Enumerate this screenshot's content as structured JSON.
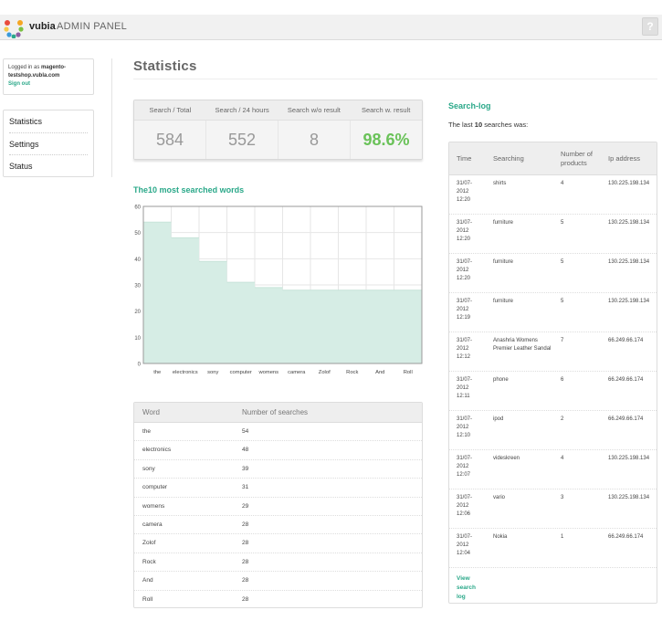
{
  "header": {
    "brand": "vubia",
    "panel_title": "ADMIN PANEL",
    "help_label": "?",
    "colors": {
      "bar": "#f1f1f1",
      "accent": "#2aa889"
    }
  },
  "sidebar": {
    "logged_in_prefix": "Logged in as",
    "user": "magento-testshop.vubla.com",
    "sign_out": "Sign out",
    "menu": [
      {
        "label": "Statistics"
      },
      {
        "label": "Settings"
      },
      {
        "label": "Status"
      }
    ]
  },
  "page": {
    "title": "Statistics"
  },
  "stats": {
    "headers": [
      "Search / Total",
      "Search / 24 hours",
      "Search w/o result",
      "Search w. result"
    ],
    "values": [
      "584",
      "552",
      "8",
      "98.6%"
    ]
  },
  "chart_section": {
    "title_prefix": "The",
    "title_count": "10",
    "title_suffix": "most searched words"
  },
  "chart_data": {
    "type": "area",
    "categories": [
      "the",
      "electronics",
      "sony",
      "computer",
      "womens",
      "camera",
      "Zolof",
      "Rock",
      "And",
      "Roll"
    ],
    "values": [
      54,
      48,
      39,
      31,
      29,
      28,
      28,
      28,
      28,
      28
    ],
    "ylim": [
      0,
      60
    ],
    "yticks": [
      0,
      10,
      20,
      30,
      40,
      50,
      60
    ],
    "grid": true,
    "color": "#d6ede5"
  },
  "words_table": {
    "headers": [
      "Word",
      "Number of searches"
    ],
    "rows": [
      {
        "word": "the",
        "count": "54"
      },
      {
        "word": "electronics",
        "count": "48"
      },
      {
        "word": "sony",
        "count": "39"
      },
      {
        "word": "computer",
        "count": "31"
      },
      {
        "word": "womens",
        "count": "29"
      },
      {
        "word": "camera",
        "count": "28"
      },
      {
        "word": "Zolof",
        "count": "28"
      },
      {
        "word": "Rock",
        "count": "28"
      },
      {
        "word": "And",
        "count": "28"
      },
      {
        "word": "Roll",
        "count": "28"
      }
    ]
  },
  "search_log": {
    "title": "Search-log",
    "subtitle_prefix": "The last",
    "subtitle_count": "10",
    "subtitle_suffix": "searches was:",
    "headers": [
      "Time",
      "Searching",
      "Number of products",
      "Ip address"
    ],
    "rows": [
      {
        "time": [
          "31/07-",
          "2012",
          "12:20"
        ],
        "search": "shirts",
        "products": "4",
        "ip": "130.225.198.134"
      },
      {
        "time": [
          "31/07-",
          "2012",
          "12:20"
        ],
        "search": "furniture",
        "products": "5",
        "ip": "130.225.198.134"
      },
      {
        "time": [
          "31/07-",
          "2012",
          "12:20"
        ],
        "search": "furniture",
        "products": "5",
        "ip": "130.225.198.134"
      },
      {
        "time": [
          "31/07-",
          "2012",
          "12:19"
        ],
        "search": "furniture",
        "products": "5",
        "ip": "130.225.198.134"
      },
      {
        "time": [
          "31/07-",
          "2012",
          "12:12"
        ],
        "search": "Anashria Womens Premier Leather Sandal",
        "products": "7",
        "ip": "66.249.66.174"
      },
      {
        "time": [
          "31/07-",
          "2012",
          "12:11"
        ],
        "search": "phone",
        "products": "6",
        "ip": "66.249.66.174"
      },
      {
        "time": [
          "31/07-",
          "2012",
          "12:10"
        ],
        "search": "ipod",
        "products": "2",
        "ip": "66.249.66.174"
      },
      {
        "time": [
          "31/07-",
          "2012",
          "12:07"
        ],
        "search": "videskreen",
        "products": "4",
        "ip": "130.225.198.134"
      },
      {
        "time": [
          "31/07-",
          "2012",
          "12:06"
        ],
        "search": "vario",
        "products": "3",
        "ip": "130.225.198.134"
      },
      {
        "time": [
          "31/07-",
          "2012",
          "12:04"
        ],
        "search": "Nokia",
        "products": "1",
        "ip": "66.249.66.174"
      }
    ],
    "view_link": "View search log"
  }
}
